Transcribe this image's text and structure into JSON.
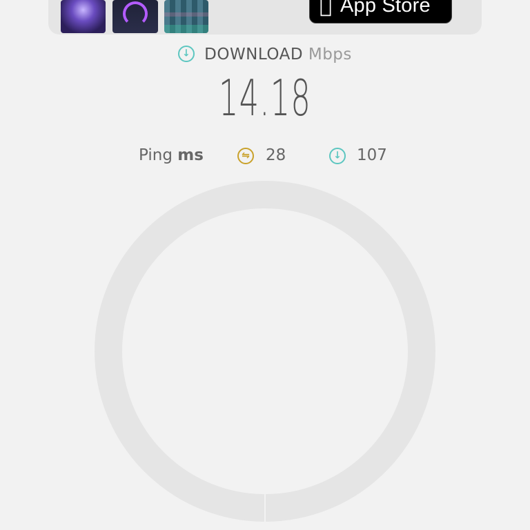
{
  "banner": {
    "thumbnails": [
      "app-screenshot-particles",
      "app-screenshot-speedometer",
      "app-screenshot-map"
    ],
    "app_store_label": "App Store",
    "apple_icon": "apple-logo-icon"
  },
  "download": {
    "icon": "download-arrow-icon",
    "title": "DOWNLOAD",
    "unit": "Mbps",
    "value": "14.18"
  },
  "ping": {
    "label_prefix": "Ping",
    "label_unit": "ms",
    "jitter_icon": "jitter-icon",
    "jitter_value": "28",
    "download_icon": "download-arrow-icon",
    "download_value": "107"
  },
  "gauge": {
    "progress_fraction": 0
  },
  "colors": {
    "teal": "#5cc6c0",
    "gold": "#c9a12a",
    "ring": "#e5e5e5",
    "background": "#f2f2f2"
  }
}
